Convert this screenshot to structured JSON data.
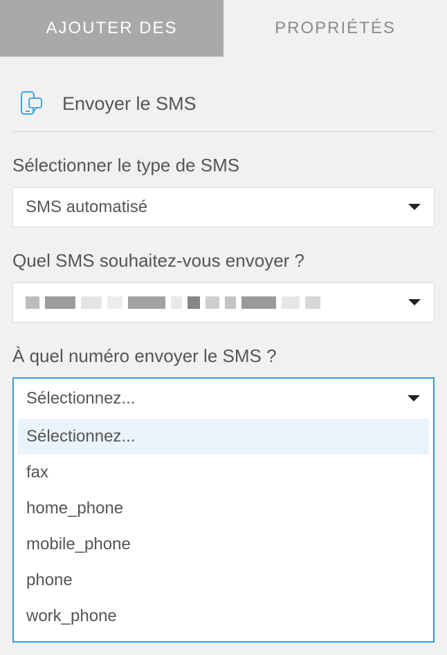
{
  "tabs": {
    "add": "AJOUTER DES",
    "properties": "PROPRIÉTÉS"
  },
  "header": {
    "title": "Envoyer le SMS"
  },
  "form": {
    "type_label": "Sélectionner le type de SMS",
    "type_value": "SMS automatisé",
    "which_label": "Quel SMS souhaitez-vous envoyer ?",
    "number_label": "À quel numéro envoyer le SMS ?",
    "number_value": "Sélectionnez...",
    "number_options": {
      "o0": "Sélectionnez...",
      "o1": "fax",
      "o2": "home_phone",
      "o3": "mobile_phone",
      "o4": "phone",
      "o5": "work_phone"
    }
  }
}
